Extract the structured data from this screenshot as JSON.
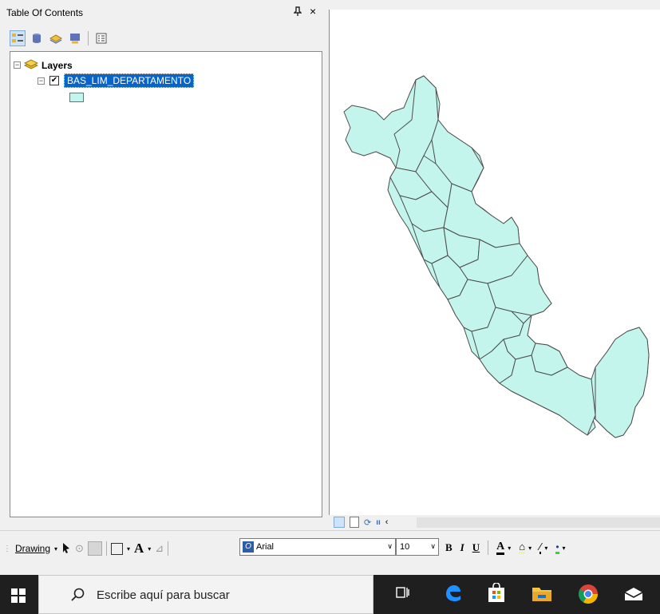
{
  "toc": {
    "title": "Table Of Contents",
    "pin_glyph": "ᵖ",
    "close_glyph": "×",
    "tree": {
      "root_label": "Layers",
      "layer_name": "BAS_LIM_DEPARTAMENTO",
      "layer_checked": true,
      "layer_fill_color": "#c3f5ec"
    }
  },
  "map": {
    "fill_color": "#c3f5ec",
    "outline_color": "#4d4d4d"
  },
  "drawing_toolbar": {
    "drawing_label": "Drawing",
    "font_name": "Arial",
    "font_size": "10",
    "bold_label": "B",
    "italic_label": "I",
    "underline_label": "U",
    "text_color_label": "A"
  },
  "taskbar": {
    "search_placeholder": "Escribe aquí para buscar"
  }
}
